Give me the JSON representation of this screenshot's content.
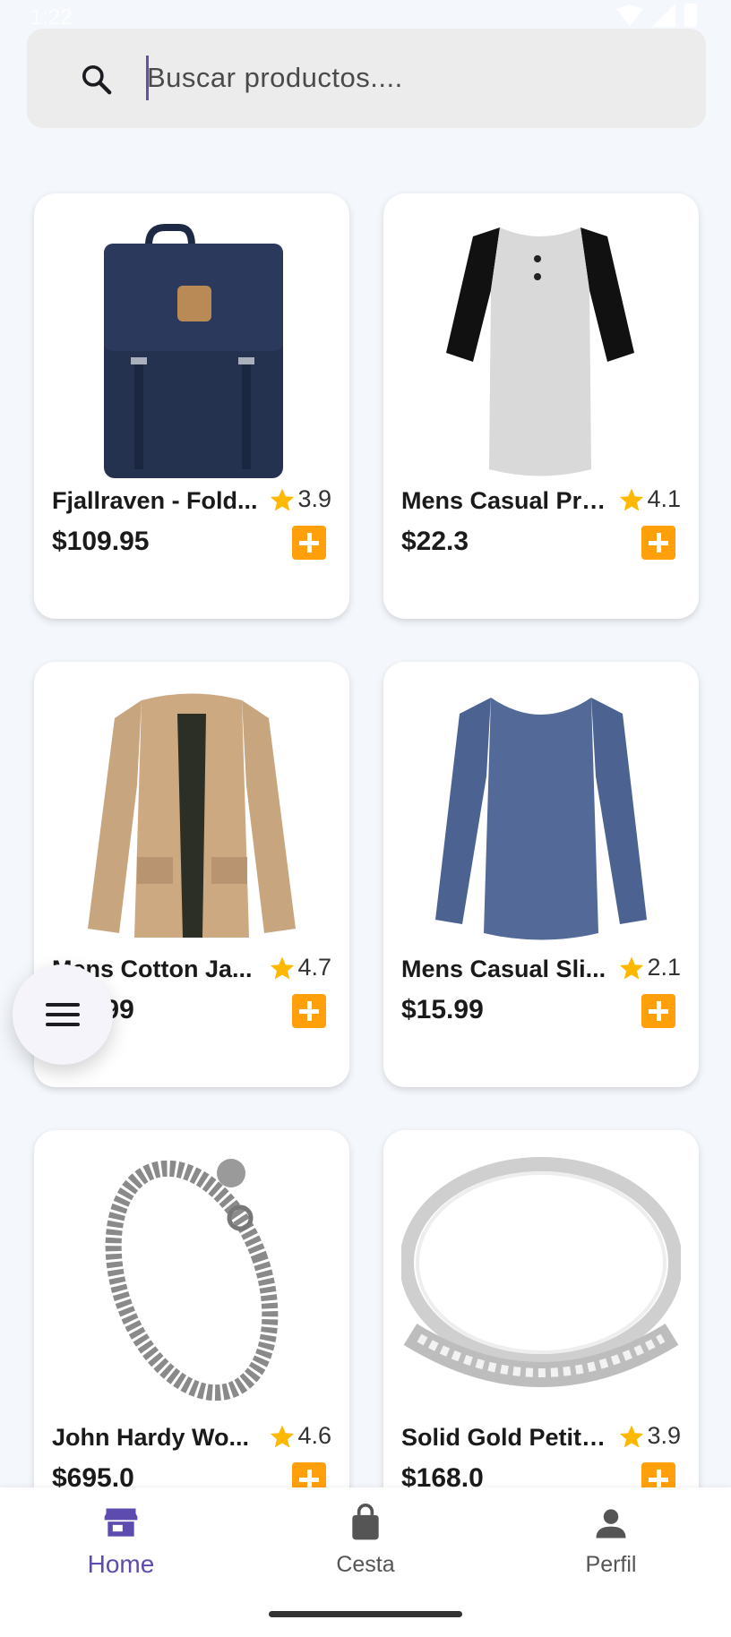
{
  "status_bar": {
    "time": "1:22"
  },
  "search": {
    "placeholder": "Buscar productos...."
  },
  "products": [
    {
      "title": "Fjallraven - Fold...",
      "rating": "3.9",
      "price": "$109.95",
      "image": "backpack"
    },
    {
      "title": "Mens Casual Pre...",
      "rating": "4.1",
      "price": "$22.3",
      "image": "raglan-shirt"
    },
    {
      "title": "Mens Cotton Ja...",
      "rating": "4.7",
      "price": "$55.99",
      "image": "cotton-jacket"
    },
    {
      "title": "Mens Casual Sli...",
      "rating": "2.1",
      "price": "$15.99",
      "image": "long-sleeve-shirt"
    },
    {
      "title": "John Hardy Wo...",
      "rating": "4.6",
      "price": "$695.0",
      "image": "chain-bracelet"
    },
    {
      "title": "Solid Gold Petite...",
      "rating": "3.9",
      "price": "$168.0",
      "image": "gold-ring"
    }
  ],
  "bottom_nav": {
    "home_label": "Home",
    "cart_label": "Cesta",
    "profile_label": "Perfil"
  },
  "colors": {
    "accent": "#6750a4",
    "add_button": "#ff9f0a",
    "star": "#ffb800",
    "background": "#f4f7fc"
  }
}
